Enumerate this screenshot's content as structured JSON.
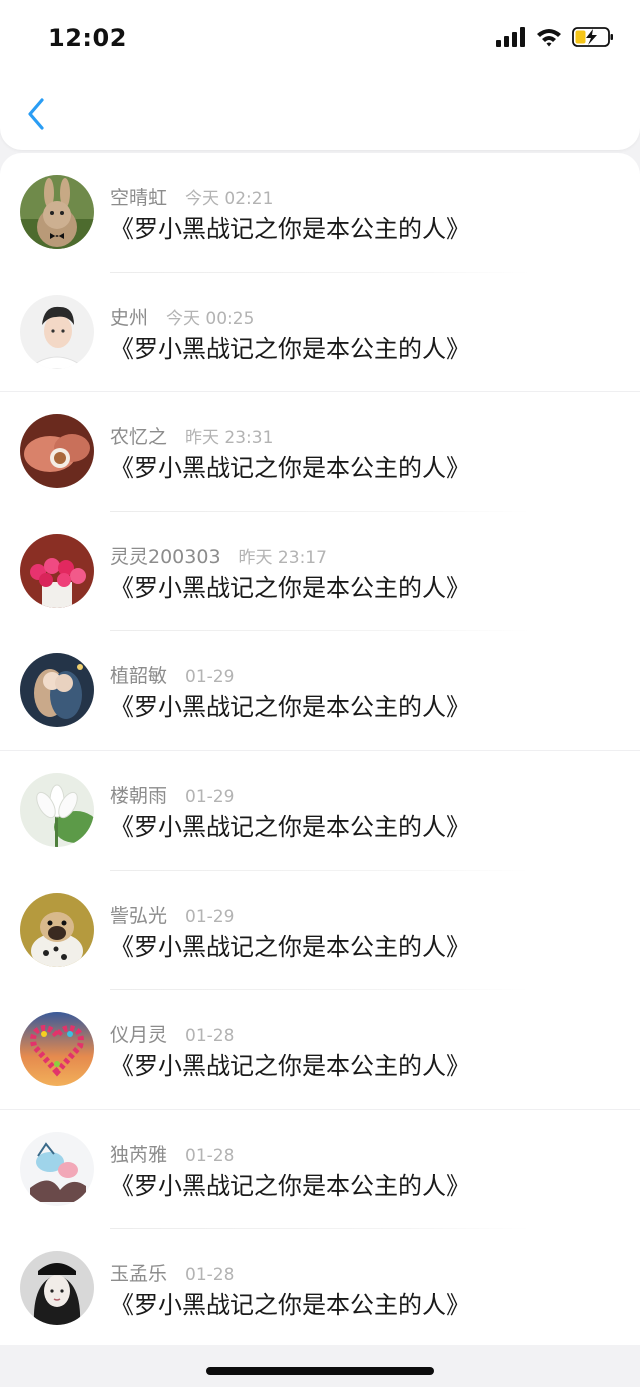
{
  "status_bar": {
    "time": "12:02",
    "icons": [
      "signal-icon",
      "wifi-icon",
      "battery-charging-icon"
    ],
    "battery_color": "#f5c518"
  },
  "nav": {
    "back_icon": "chevron-left-icon",
    "accent_color": "#2a9df4"
  },
  "items": [
    {
      "name": "空晴虹",
      "time": "今天 02:21",
      "title": "《罗小黑战记之你是本公主的人》",
      "avatar": "rabbit-avatar"
    },
    {
      "name": "史州",
      "time": "今天 00:25",
      "title": "《罗小黑战记之你是本公主的人》",
      "avatar": "young-man-avatar"
    },
    {
      "name": "农忆之",
      "time": "昨天 23:31",
      "title": "《罗小黑战记之你是本公主的人》",
      "avatar": "hands-coffee-avatar"
    },
    {
      "name": "灵灵200303",
      "time": "昨天 23:17",
      "title": "《罗小黑战记之你是本公主的人》",
      "avatar": "pink-roses-avatar"
    },
    {
      "name": "植韶敏",
      "time": "01-29",
      "title": "《罗小黑战记之你是本公主的人》",
      "avatar": "anime-couple-avatar"
    },
    {
      "name": "楼朝雨",
      "time": "01-29",
      "title": "《罗小黑战记之你是本公主的人》",
      "avatar": "lotus-avatar"
    },
    {
      "name": "訾弘光",
      "time": "01-29",
      "title": "《罗小黑战记之你是本公主的人》",
      "avatar": "pug-dog-avatar"
    },
    {
      "name": "仪月灵",
      "time": "01-28",
      "title": "《罗小黑战记之你是本公主的人》",
      "avatar": "balloon-heart-avatar"
    },
    {
      "name": "独芮雅",
      "time": "01-28",
      "title": "《罗小黑战记之你是本公主的人》",
      "avatar": "ink-illustration-avatar"
    },
    {
      "name": "玉孟乐",
      "time": "01-28",
      "title": "《罗小黑战记之你是本公主的人》",
      "avatar": "girl-bw-avatar"
    }
  ]
}
